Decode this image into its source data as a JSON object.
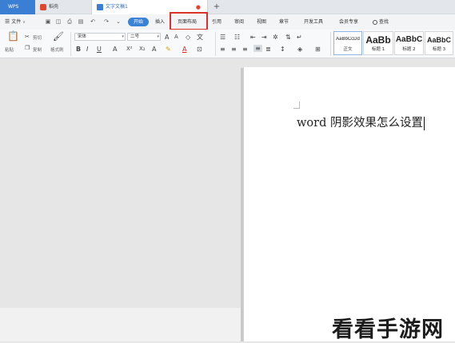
{
  "tabs": {
    "app": "WPS",
    "home": "稻壳",
    "document": "文字文稿1",
    "add": "+"
  },
  "menu": {
    "file": "文件",
    "file_arrow": "∨",
    "quick_icons": [
      "save-icon",
      "print-preview-icon",
      "print-icon",
      "undo-icon",
      "redo-icon"
    ],
    "start": "开始",
    "insert": "插入",
    "page_layout": "页面布局",
    "references": "引用",
    "review": "审阅",
    "view": "视图",
    "section": "章节",
    "developer": "开发工具",
    "member": "会员专享",
    "search": "查找"
  },
  "ribbon": {
    "paste": "粘贴",
    "cut": "剪切",
    "copy": "复制",
    "format_painter": "格式刷",
    "font_name": "宋体",
    "font_size": "二号",
    "bold": "B",
    "italic": "I",
    "underline": "U",
    "styles": [
      {
        "sample": "AaBbCcDd",
        "name": "正文"
      },
      {
        "sample": "AaBb",
        "name": "标题 1"
      },
      {
        "sample": "AaBbC",
        "name": "标题 2"
      },
      {
        "sample": "AaBbC",
        "name": "标题 3"
      }
    ]
  },
  "document": {
    "text": "word 阴影效果怎么设置"
  },
  "watermark": "看看手游网",
  "colors": {
    "accent": "#3a82d6",
    "highlight_box": "#d9312c",
    "wps_tab": "#3b7fd4"
  }
}
